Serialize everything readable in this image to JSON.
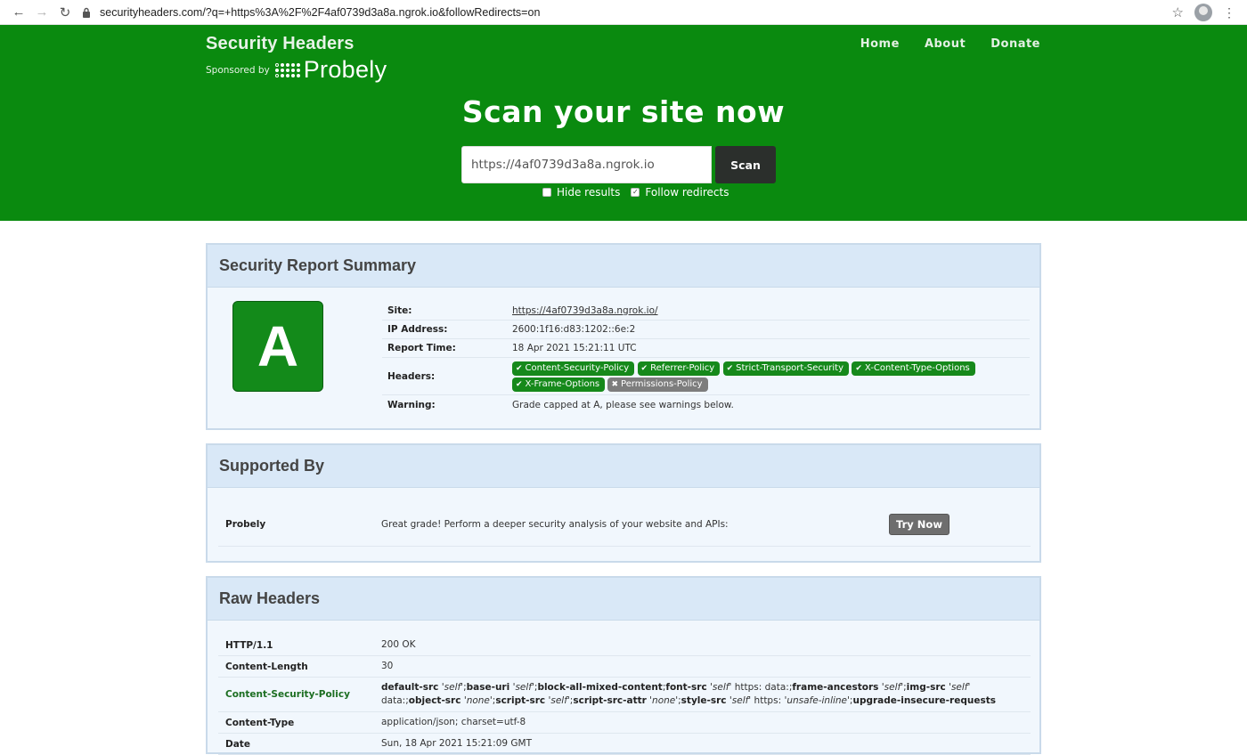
{
  "browser": {
    "url": "securityheaders.com/?q=+https%3A%2F%2F4af0739d3a8a.ngrok.io&followRedirects=on"
  },
  "header": {
    "brand_title": "Security Headers",
    "sponsored_by": "Sponsored by",
    "sponsor_name": "Probely",
    "nav": [
      "Home",
      "About",
      "Donate"
    ],
    "heading": "Scan your site now",
    "scan_input_value": "https://4af0739d3a8a.ngrok.io",
    "scan_button": "Scan",
    "hide_results_label": "Hide results",
    "follow_redirects_label": "Follow redirects",
    "follow_redirects_checked": "✓"
  },
  "summary": {
    "title": "Security Report Summary",
    "grade": "A",
    "site_label": "Site:",
    "site_value": "https://4af0739d3a8a.ngrok.io/",
    "ip_label": "IP Address:",
    "ip_value": "2600:1f16:d83:1202::6e:2",
    "time_label": "Report Time:",
    "time_value": "18 Apr 2021 15:21:11 UTC",
    "headers_label": "Headers:",
    "headers": [
      {
        "name": "Content-Security-Policy",
        "ok": true
      },
      {
        "name": "Referrer-Policy",
        "ok": true
      },
      {
        "name": "Strict-Transport-Security",
        "ok": true
      },
      {
        "name": "X-Content-Type-Options",
        "ok": true
      },
      {
        "name": "X-Frame-Options",
        "ok": true
      },
      {
        "name": "Permissions-Policy",
        "ok": false
      }
    ],
    "warning_label": "Warning:",
    "warning_value": "Grade capped at A, please see warnings below."
  },
  "supported": {
    "title": "Supported By",
    "name": "Probely",
    "text": "Great grade! Perform a deeper security analysis of your website and APIs:",
    "button": "Try Now"
  },
  "raw": {
    "title": "Raw Headers",
    "rows": [
      {
        "key": "HTTP/1.1",
        "value": "200 OK"
      },
      {
        "key": "Content-Length",
        "value": "30"
      },
      {
        "key": "Content-Security-Policy",
        "value": "default-src 'self';base-uri 'self';block-all-mixed-content;font-src 'self' https: data:;frame-ancestors 'self';img-src 'self' data:;object-src 'none';script-src 'self';script-src-attr 'none';style-src 'self' https: 'unsafe-inline';upgrade-insecure-requests"
      },
      {
        "key": "Content-Type",
        "value": "application/json; charset=utf-8"
      },
      {
        "key": "Date",
        "value": "Sun, 18 Apr 2021 15:21:09 GMT"
      }
    ]
  },
  "colors": {
    "brand_green": "#0a8a0f",
    "pill_green": "#16891b",
    "pill_grey": "#7d7d7d",
    "panel_header": "#d9e8f7"
  }
}
